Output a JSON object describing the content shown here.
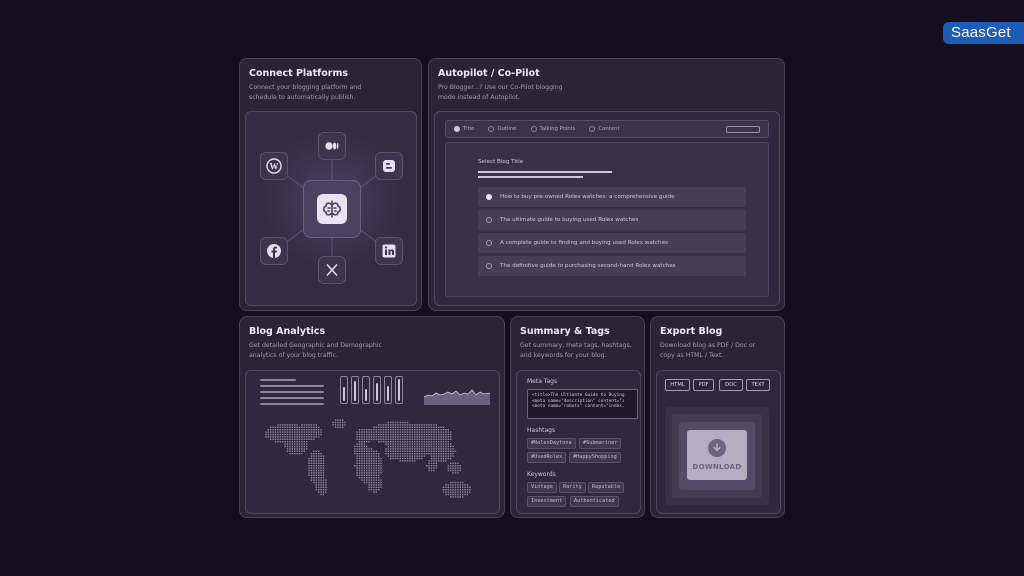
{
  "brand": {
    "name": "SaasGet"
  },
  "connect": {
    "title": "Connect Platforms",
    "desc_line1": "Connect your blogging platform and",
    "desc_line2": "schedule to automatically publish.",
    "platforms": [
      "wordpress-icon",
      "medium-icon",
      "blogger-icon",
      "facebook-icon",
      "x-icon",
      "linkedin-icon"
    ]
  },
  "autopilot": {
    "title": "Autopilot / Co-Pilot",
    "desc_line1": "Pro Blogger...?  Use our Co-Pilot blogging",
    "desc_line2": "mode instead of Autopilot.",
    "tabs": [
      "Title",
      "Outline",
      "Talking Points",
      "Content"
    ],
    "select_label": "Select Blog Title",
    "options": [
      "How to buy pre-owned Rolex watches: a comprehensive guide",
      "The ultimate guide to buying used Rolex watches",
      "A complete guide to finding and buying used Rolex watches",
      "The definitive guide to purchasing second-hand Rolex watches"
    ]
  },
  "analytics": {
    "title": "Blog Analytics",
    "desc_line1": "Get detailed Geographic and Demographic",
    "desc_line2": "analytics of your blog traffic."
  },
  "summary": {
    "title": "Summary & Tags",
    "desc_line1": "Get summary, meta tags, hashtags,",
    "desc_line2": "and keywords for your blog.",
    "meta_label": "Meta Tags",
    "meta_lines": [
      "<title>The Ultimate Guide to Buying",
      "<meta name=\"description\" content=\"i",
      "<meta name=\"robots\" content=\"index,"
    ],
    "hashtags_label": "Hashtags",
    "hashtags": [
      "#RolexDaytona",
      "#Submariner",
      "#UsedRolex",
      "#HappyShopping"
    ],
    "keywords_label": "Keywords",
    "keywords": [
      "Vintage",
      "Rarity",
      "Reputable",
      "Investment",
      "Authenticated"
    ]
  },
  "export": {
    "title": "Export Blog",
    "desc_line1": "Download blog as PDF / Doc or",
    "desc_line2": "copy as HTML / Text.",
    "formats": [
      "HTML",
      "PDF",
      "DOC",
      "TEXT"
    ],
    "download_label": "DOWNLOAD"
  }
}
